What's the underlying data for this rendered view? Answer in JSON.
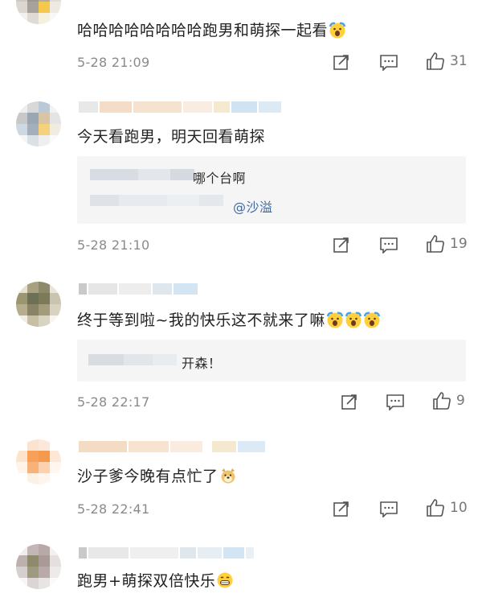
{
  "comments": [
    {
      "text": "哈哈哈哈哈哈哈哈跑男和萌探一起看",
      "emoji": "scream-face",
      "date": "5-28 21:09",
      "likes": "31"
    },
    {
      "text": "今天看跑男，明天回看萌探",
      "date": "5-28 21:10",
      "likes": "19",
      "reply": {
        "text": "哪个台啊",
        "mention": "@沙溢"
      }
    },
    {
      "text": "终于等到啦~我的快乐这不就来了嘛",
      "emoji": "scream-face",
      "emoji_count": 3,
      "date": "5-28 22:17",
      "likes": "9",
      "reply": {
        "text": "开森！"
      }
    },
    {
      "text": "沙子爹今晚有点忙了",
      "emoji": "doge-face",
      "date": "5-28 22:41",
      "likes": "10"
    },
    {
      "text": "跑男+萌探双倍快乐",
      "emoji": "grin-face"
    }
  ],
  "icons": {
    "share": "share-icon",
    "comment": "comment-icon",
    "like": "like-icon"
  },
  "colors": {
    "text": "#222222",
    "meta": "#8a8a8a",
    "mention": "#3d6aa6",
    "reply_bg": "#f5f5f5"
  }
}
